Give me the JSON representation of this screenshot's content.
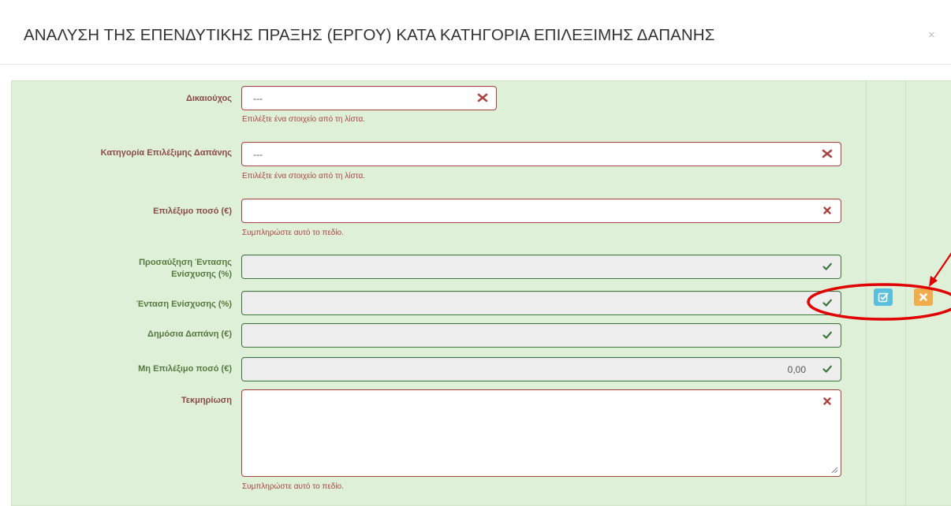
{
  "modal": {
    "title": "ΑΝΑΛΥΣΗ ΤΗΣ ΕΠΕΝΔΥΤΙΚΗΣ ΠΡΑΞΗΣ (ΕΡΓΟΥ) ΚΑΤΑ ΚΑΤΗΓΟΡΙΑ ΕΠΙΛΕΞΙΜΗΣ ΔΑΠΑΝΗΣ",
    "close_symbol": "×"
  },
  "form": {
    "beneficiary": {
      "label": "Δικαιούχος",
      "value": "---",
      "help": "Επιλέξτε ένα στοιχείο από τη λίστα."
    },
    "category": {
      "label": "Κατηγορία Επιλέξιμης Δαπάνης",
      "value": "---",
      "help": "Επιλέξτε ένα στοιχείο από τη λίστα."
    },
    "eligible_amount": {
      "label": "Επιλέξιμο ποσό (€)",
      "value": "",
      "help": "Συμπληρώστε αυτό το πεδίο."
    },
    "intensity_increase": {
      "label_line1": "Προσαύξηση Έντασης",
      "label_line2": "Ενίσχυσης (%)",
      "value": ""
    },
    "aid_intensity": {
      "label": "Ένταση Ενίσχυσης (%)",
      "value": ""
    },
    "public_expenditure": {
      "label": "Δημόσια Δαπάνη (€)",
      "value": ""
    },
    "non_eligible_amount": {
      "label": "Μη Επιλέξιμο ποσό (€)",
      "value": "0,00"
    },
    "justification": {
      "label": "Τεκμηρίωση",
      "value": "",
      "help": "Συμπληρώστε αυτό το πεδίο."
    }
  },
  "row_actions": {
    "edit_icon": "edit-icon",
    "cancel_icon": "cancel-icon"
  },
  "colors": {
    "panel_bg": "#dff0d8",
    "error_red": "#a94442",
    "success_green": "#3c763d",
    "edit_blue": "#5bc0de",
    "cancel_orange": "#f0ad4e",
    "annotation_red": "#e00000"
  }
}
